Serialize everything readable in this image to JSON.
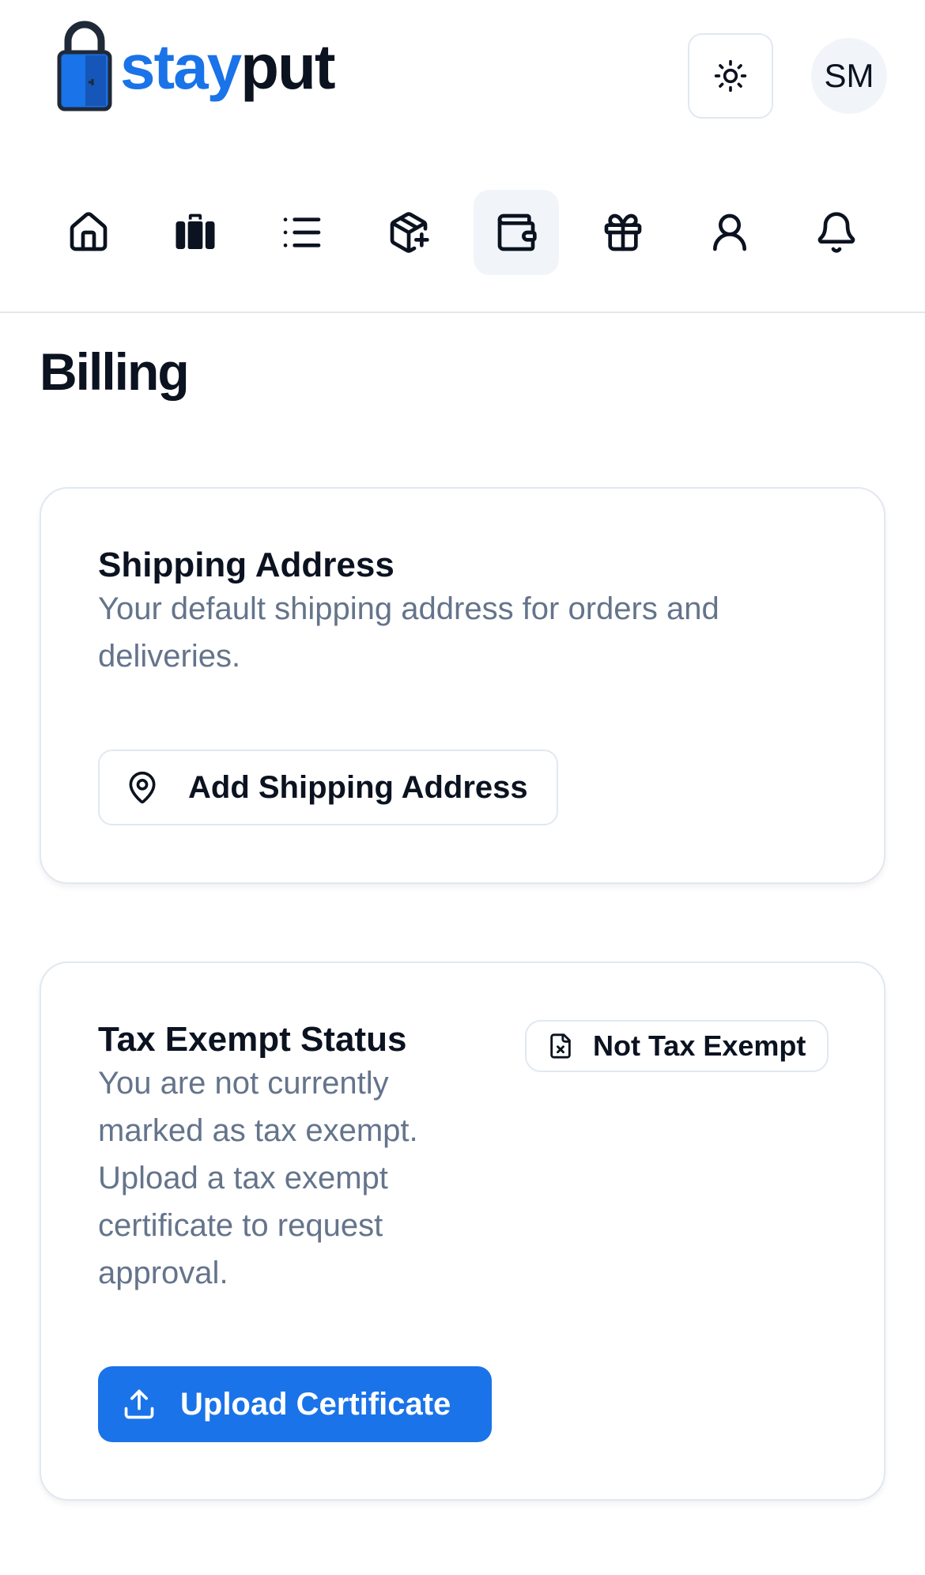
{
  "brand": {
    "part1": "stay",
    "part2": "put",
    "accent_color": "#1a73e8"
  },
  "header": {
    "theme_icon": "sun-icon",
    "avatar_initials": "SM"
  },
  "nav": {
    "items": [
      {
        "icon": "home-icon",
        "active": false
      },
      {
        "icon": "luggage-icon",
        "active": false
      },
      {
        "icon": "list-icon",
        "active": false
      },
      {
        "icon": "package-plus-icon",
        "active": false
      },
      {
        "icon": "wallet-icon",
        "active": true
      },
      {
        "icon": "gift-icon",
        "active": false
      },
      {
        "icon": "user-icon",
        "active": false
      },
      {
        "icon": "bell-icon",
        "active": false
      }
    ]
  },
  "page": {
    "title": "Billing"
  },
  "shipping": {
    "title": "Shipping Address",
    "description": "Your default shipping address for orders and deliveries.",
    "button_label": "Add Shipping Address",
    "button_icon": "map-pin-icon"
  },
  "tax": {
    "title": "Tax Exempt Status",
    "description": "You are not currently marked as tax exempt. Upload a tax exempt certificate to request approval.",
    "badge_label": "Not Tax Exempt",
    "badge_icon": "file-x-icon",
    "button_label": "Upload Certificate",
    "button_icon": "upload-icon"
  }
}
